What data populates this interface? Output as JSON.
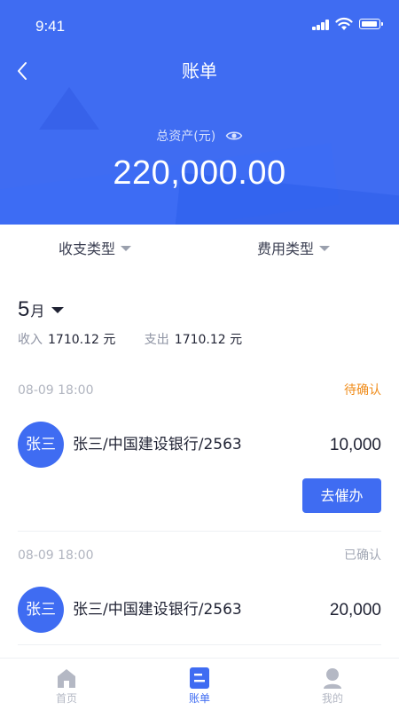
{
  "status_bar": {
    "time": "9:41"
  },
  "nav": {
    "title": "账单",
    "back_icon": "chevron-left-icon"
  },
  "assets": {
    "label": "总资产(元)",
    "value": "220,000.00",
    "visibility_icon": "eye-icon"
  },
  "filters": [
    {
      "label": "收支类型",
      "icon": "caret-down-icon"
    },
    {
      "label": "费用类型",
      "icon": "caret-down-icon"
    }
  ],
  "month": {
    "number": "5",
    "unit": "月",
    "income_label": "收入",
    "income_value": "1710.12 元",
    "expense_label": "支出",
    "expense_value": "1710.12 元"
  },
  "records": [
    {
      "time": "08-09 18:00",
      "status": "待确认",
      "status_color": "#f08c1a",
      "avatar": "张三",
      "name": "张三/中国建设银行/2563",
      "amount": "10,000",
      "action": "去催办"
    },
    {
      "time": "08-09 18:00",
      "status": "已确认",
      "status_color": "#a3a8b5",
      "avatar": "张三",
      "name": "张三/中国建设银行/2563",
      "amount": "20,000"
    }
  ],
  "tabs": [
    {
      "label": "首页",
      "icon": "home-icon",
      "active": false
    },
    {
      "label": "账单",
      "icon": "bill-icon",
      "active": true
    },
    {
      "label": "我的",
      "icon": "profile-icon",
      "active": false
    }
  ],
  "colors": {
    "primary": "#3f6cf2",
    "pending": "#f08c1a",
    "inactive": "#b4b8c4"
  }
}
